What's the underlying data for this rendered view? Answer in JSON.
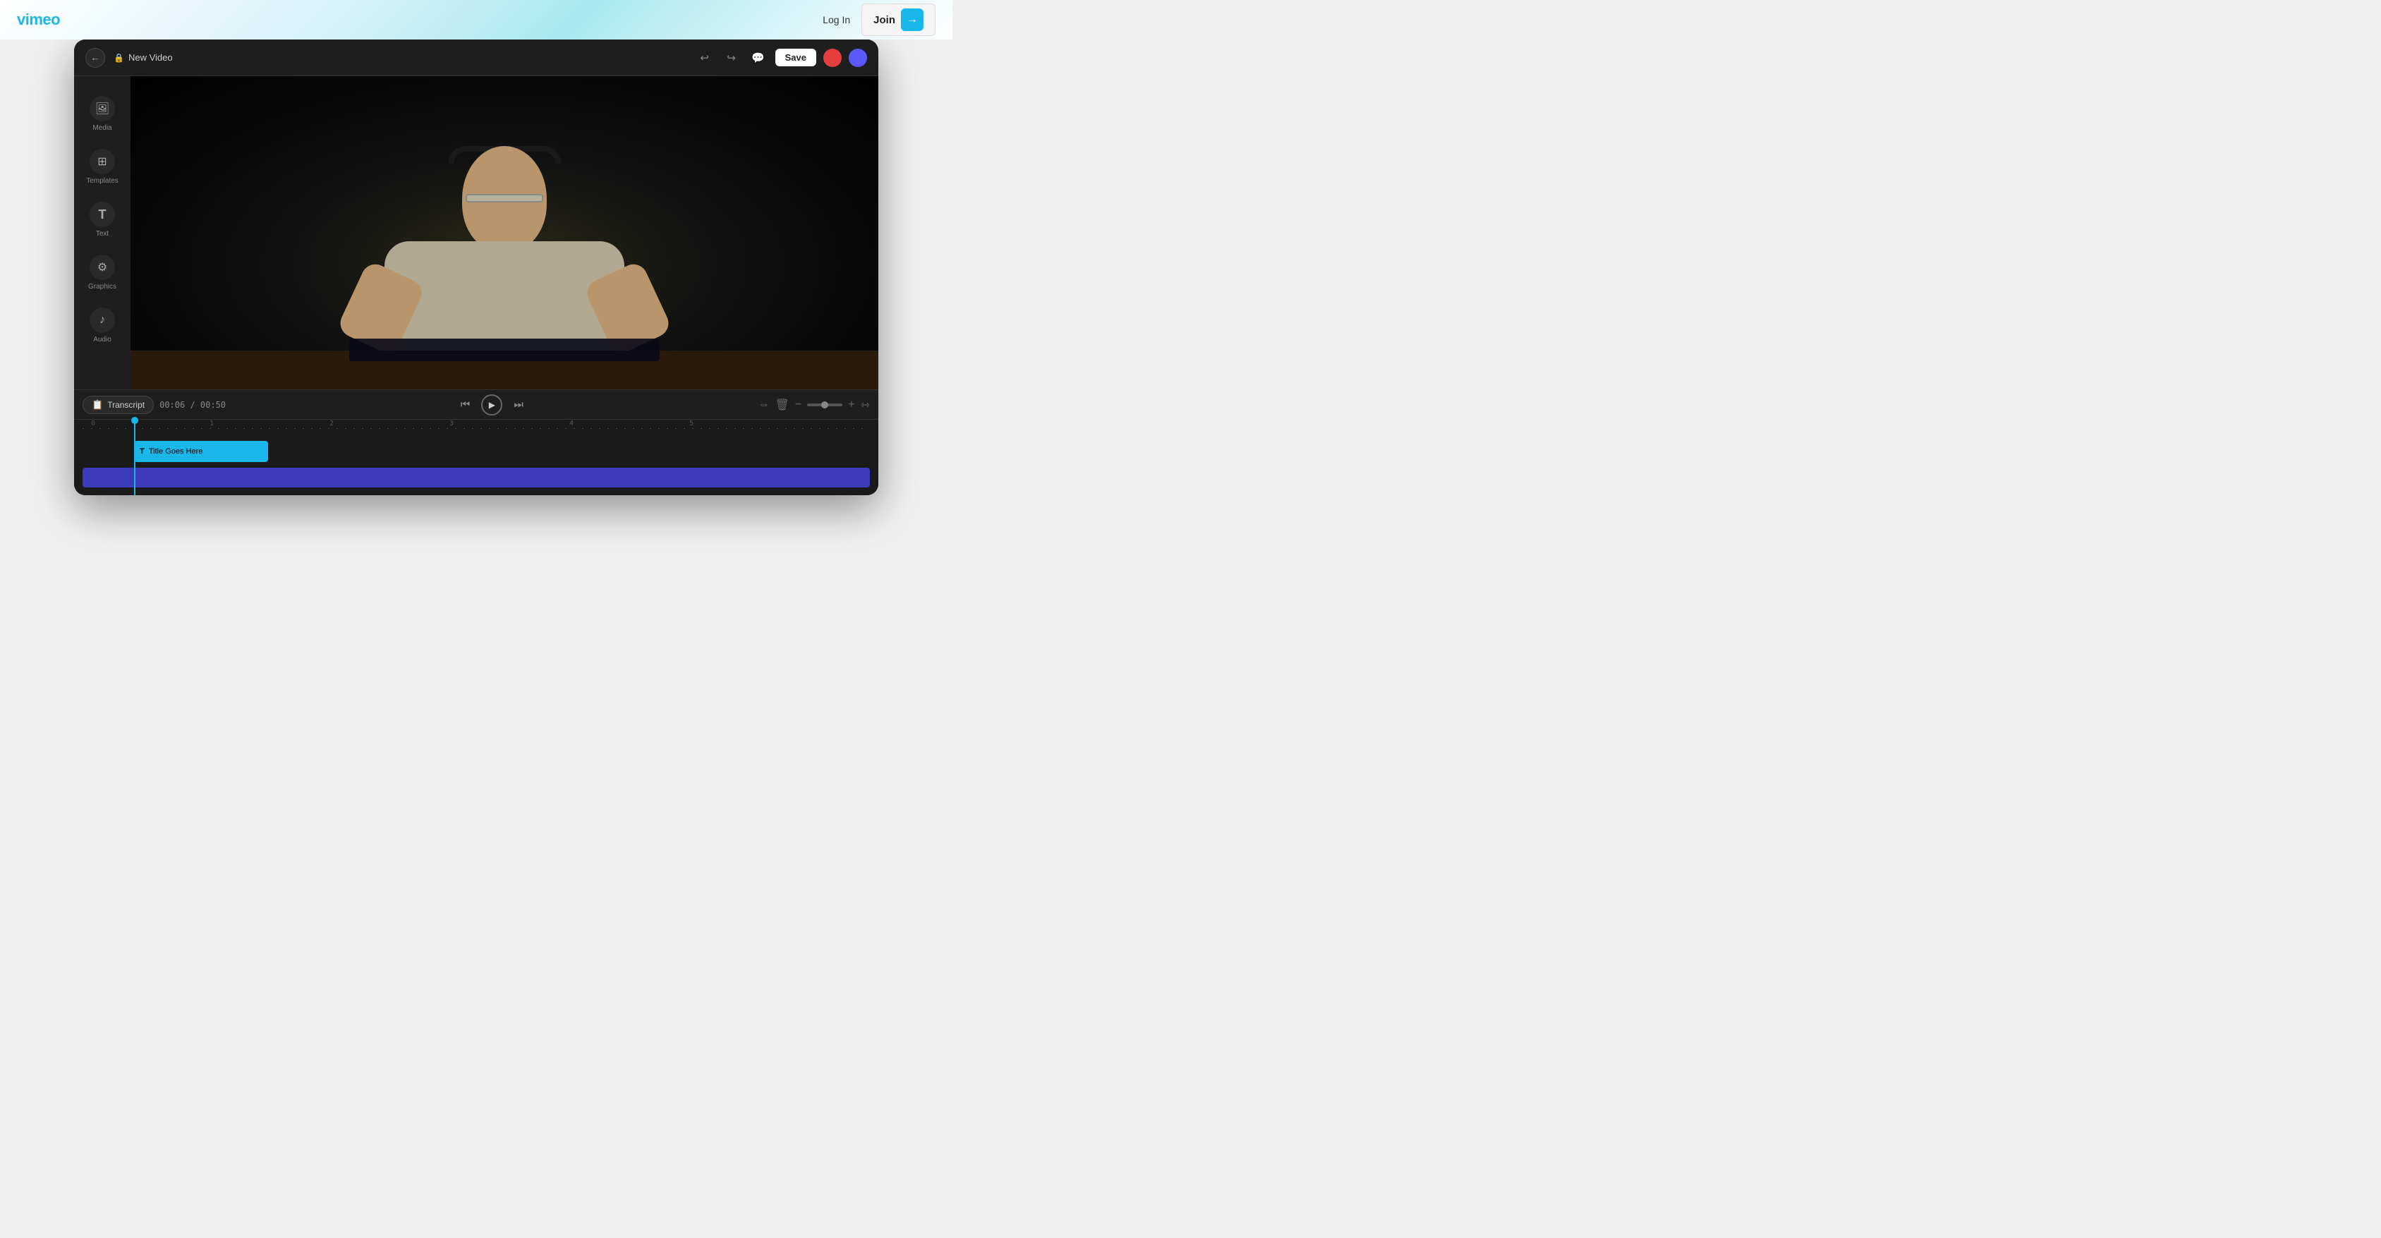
{
  "topbar": {
    "logo": "vimeo",
    "login_label": "Log In",
    "join_label": "Join",
    "join_arrow": "→"
  },
  "editor": {
    "title": "New Video",
    "lock_symbol": "🔒",
    "back_arrow": "←",
    "header_buttons": {
      "undo": "↩",
      "redo": "↪",
      "comment": "💬",
      "save": "Save"
    },
    "avatars": {
      "red_initial": "",
      "blue_initial": ""
    }
  },
  "sidebar": {
    "items": [
      {
        "id": "media",
        "label": "Media",
        "icon": "🖼"
      },
      {
        "id": "templates",
        "label": "Templates",
        "icon": "⊞"
      },
      {
        "id": "text",
        "label": "Text",
        "icon": "T"
      },
      {
        "id": "graphics",
        "label": "Graphics",
        "icon": "⚙"
      },
      {
        "id": "audio",
        "label": "Audio",
        "icon": "♪"
      }
    ]
  },
  "timeline": {
    "transcript_label": "Transcript",
    "time_current": "00:06",
    "time_total": "00:50",
    "time_separator": "/",
    "ruler_marks": [
      "0",
      "1",
      "2",
      "3",
      "4",
      "5"
    ],
    "title_track_label": "Title Goes Here",
    "title_track_prefix": "T",
    "controls": {
      "skip_back": "⏮",
      "play": "▶",
      "skip_forward": "⏭"
    },
    "right_controls": {
      "fit": "⇔",
      "delete": "🗑",
      "zoom_out": "−",
      "zoom_slider": "",
      "zoom_in": "+",
      "expand": "⇿"
    }
  }
}
